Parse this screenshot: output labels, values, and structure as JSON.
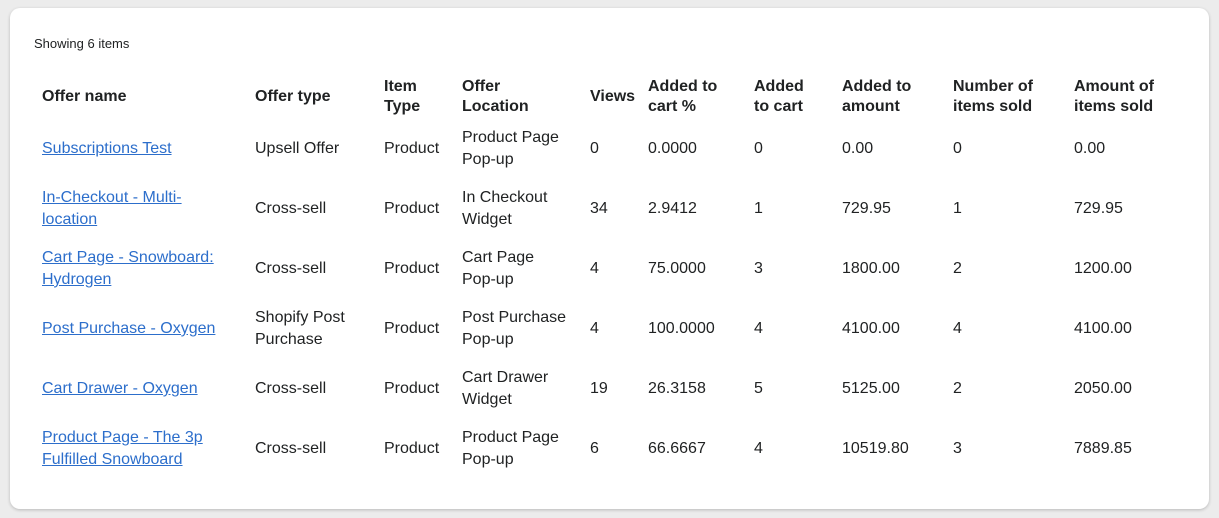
{
  "summary": "Showing 6 items",
  "colors": {
    "link": "#2c6ecb",
    "background": "#ececec",
    "card": "#ffffff"
  },
  "table": {
    "headers": [
      "Offer name",
      "Offer type",
      "Item Type",
      "Offer Location",
      "Views",
      "Added to cart %",
      "Added to cart",
      "Added to amount",
      "Number of items sold",
      "Amount of items sold"
    ],
    "rows": [
      {
        "offer_name": "Subscriptions Test",
        "offer_type": "Upsell Offer",
        "item_type": "Product",
        "location": "Product Page Pop-up",
        "views": "0",
        "cart_pct": "0.0000",
        "added_to_cart": "0",
        "added_amount": "0.00",
        "items_sold": "0",
        "amount_sold": "0.00"
      },
      {
        "offer_name": "In-Checkout - Multi-location",
        "offer_type": "Cross-sell",
        "item_type": "Product",
        "location": "In Checkout Widget",
        "views": "34",
        "cart_pct": "2.9412",
        "added_to_cart": "1",
        "added_amount": "729.95",
        "items_sold": "1",
        "amount_sold": "729.95"
      },
      {
        "offer_name": "Cart Page - Snowboard: Hydrogen",
        "offer_type": "Cross-sell",
        "item_type": "Product",
        "location": "Cart Page Pop-up",
        "views": "4",
        "cart_pct": "75.0000",
        "added_to_cart": "3",
        "added_amount": "1800.00",
        "items_sold": "2",
        "amount_sold": "1200.00"
      },
      {
        "offer_name": "Post Purchase - Oxygen",
        "offer_type": "Shopify Post Purchase",
        "item_type": "Product",
        "location": "Post Purchase Pop-up",
        "views": "4",
        "cart_pct": "100.0000",
        "added_to_cart": "4",
        "added_amount": "4100.00",
        "items_sold": "4",
        "amount_sold": "4100.00"
      },
      {
        "offer_name": "Cart Drawer - Oxygen",
        "offer_type": "Cross-sell",
        "item_type": "Product",
        "location": "Cart Drawer Widget",
        "views": "19",
        "cart_pct": "26.3158",
        "added_to_cart": "5",
        "added_amount": "5125.00",
        "items_sold": "2",
        "amount_sold": "2050.00"
      },
      {
        "offer_name": "Product Page - The 3p Fulfilled Snowboard",
        "offer_type": "Cross-sell",
        "item_type": "Product",
        "location": "Product Page Pop-up",
        "views": "6",
        "cart_pct": "66.6667",
        "added_to_cart": "4",
        "added_amount": "10519.80",
        "items_sold": "3",
        "amount_sold": "7889.85"
      }
    ]
  }
}
